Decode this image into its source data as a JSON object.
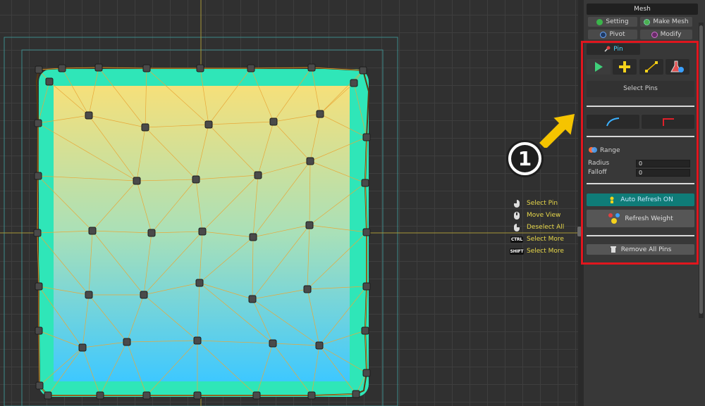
{
  "colors": {
    "accent_teal": "#2fe6b8",
    "fill_top": "#f5e07c",
    "fill_bottom": "#3ec6ff",
    "wire": "#e8a83a",
    "hint_text": "#e8d84a",
    "highlight_red": "#e0161e",
    "callout_yellow": "#f5c400"
  },
  "panel": {
    "title": "Mesh",
    "tabs": [
      {
        "label": "Setting",
        "icon": "setting-icon"
      },
      {
        "label": "Make Mesh",
        "icon": "make-mesh-icon"
      },
      {
        "label": "Pivot",
        "icon": "pivot-icon"
      },
      {
        "label": "Modify",
        "icon": "modify-icon"
      }
    ],
    "pin_tab": "Pin",
    "tools": [
      {
        "name": "select-tool",
        "icon": "play-arrow-icon"
      },
      {
        "name": "add-pin-tool",
        "icon": "plus-icon"
      },
      {
        "name": "link-pin-tool",
        "icon": "link-line-icon"
      },
      {
        "name": "test-pin-tool",
        "icon": "flask-icon"
      }
    ],
    "mode_label": "Select Pins",
    "curve_buttons": [
      {
        "name": "curve-smooth-button",
        "icon": "smooth-curve-icon"
      },
      {
        "name": "curve-corner-button",
        "icon": "corner-curve-icon"
      }
    ],
    "range": {
      "label": "Range",
      "radius_label": "Radius",
      "radius_value": "0",
      "falloff_label": "Falloff",
      "falloff_value": "0"
    },
    "auto_refresh": "Auto Refresh ON",
    "refresh_weight": "Refresh Weight",
    "remove_all": "Remove All Pins"
  },
  "hints": [
    {
      "icon": "mouse-left-icon",
      "label": "Select Pin"
    },
    {
      "icon": "mouse-middle-icon",
      "label": "Move View"
    },
    {
      "icon": "mouse-right-icon",
      "label": "Deselect All"
    },
    {
      "icon": "ctrl-key-icon",
      "key": "CTRL",
      "label": "Select More"
    },
    {
      "icon": "shift-key-icon",
      "key": "SHIFT",
      "label": "Select More"
    }
  ],
  "callout": {
    "number": "1"
  }
}
